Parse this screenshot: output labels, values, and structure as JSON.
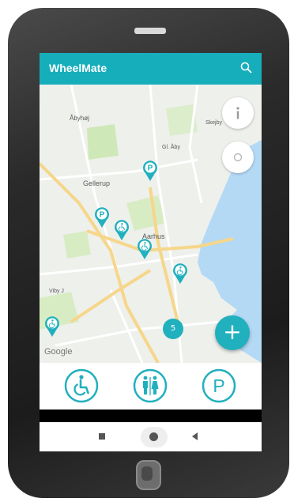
{
  "app": {
    "title": "WheelMate"
  },
  "map": {
    "labels": [
      {
        "key": "aabyhoj",
        "text": "Åbyhøj"
      },
      {
        "key": "gellerup",
        "text": "Gellerup"
      },
      {
        "key": "skejby",
        "text": "Skejby"
      },
      {
        "key": "gl_aaby",
        "text": "Gl. Åby"
      },
      {
        "key": "aarhus",
        "text": "Aarhus"
      },
      {
        "key": "viby",
        "text": "Viby J"
      }
    ],
    "attribution": "Google",
    "cluster_count": "5"
  },
  "fab": {
    "symbol": "+"
  },
  "icons": {
    "search": "search-icon",
    "info": "info-icon",
    "location": "location-icon",
    "parking_pin": "parking-pin-icon",
    "wheelchair_pin": "wheelchair-pin-icon",
    "wheelchair": "wheelchair-icon",
    "toilet": "toilet-icon",
    "parking": "parking-icon"
  },
  "colors": {
    "accent": "#17aebc",
    "water": "#b3d9f5",
    "park": "#cfe8b8"
  }
}
